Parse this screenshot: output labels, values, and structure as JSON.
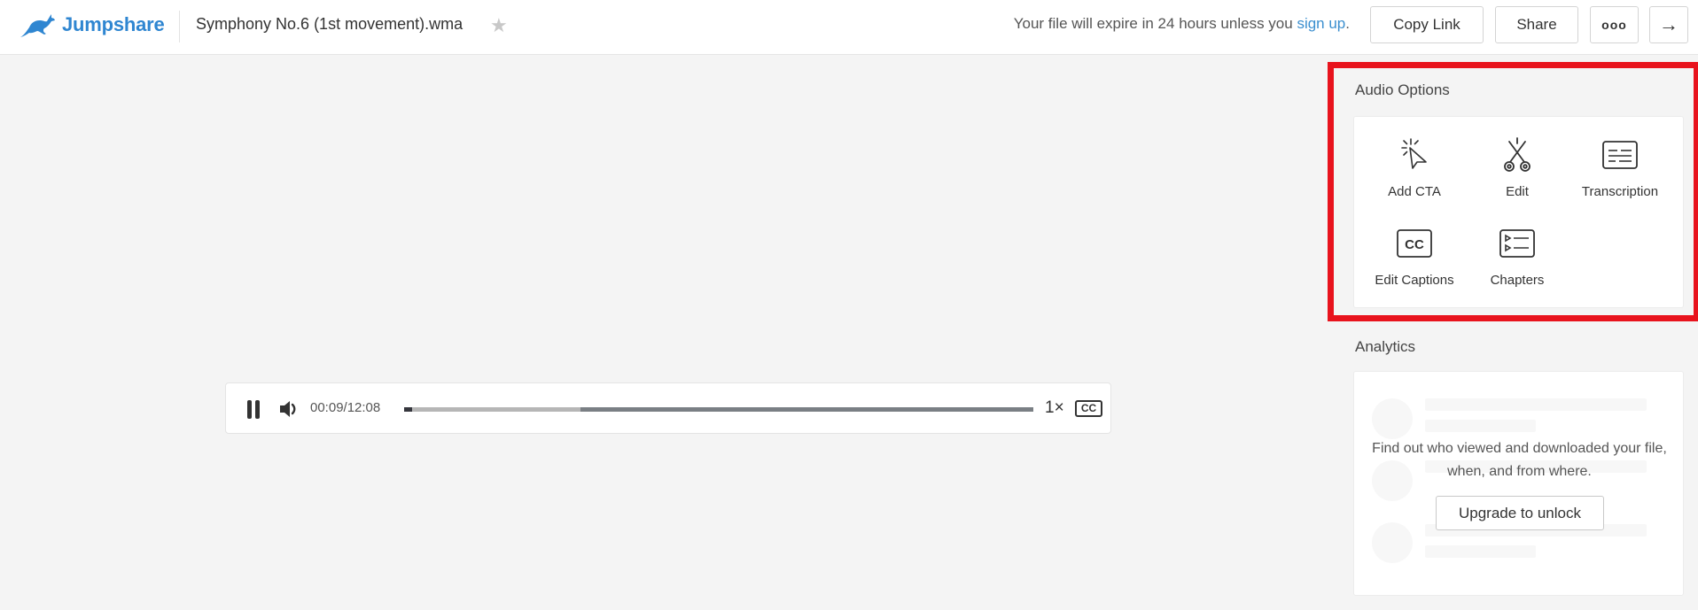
{
  "header": {
    "brand": "Jumpshare",
    "file_title": "Symphony No.6 (1st movement).wma",
    "expire_text": "Your file will expire in 24 hours unless you ",
    "expire_link": "sign up",
    "expire_suffix": ".",
    "copy_link_label": "Copy Link",
    "share_label": "Share",
    "more_label": "ooo",
    "next_label": "→"
  },
  "player": {
    "time": "00:09/12:08",
    "played_fraction": 0.012,
    "buffered_fraction": 0.28,
    "speed": "1×",
    "cc_label": "CC"
  },
  "audio_options": {
    "title": "Audio Options",
    "items": [
      {
        "label": "Add CTA",
        "icon": "cursor-click-icon"
      },
      {
        "label": "Edit",
        "icon": "scissors-icon"
      },
      {
        "label": "Transcription",
        "icon": "transcript-icon"
      },
      {
        "label": "Edit Captions",
        "icon": "cc-icon"
      },
      {
        "label": "Chapters",
        "icon": "chapters-icon"
      }
    ]
  },
  "analytics": {
    "title": "Analytics",
    "message": "Find out who viewed and downloaded your file, when, and from where.",
    "upgrade_label": "Upgrade to unlock"
  },
  "colors": {
    "brand": "#2f86d1",
    "highlight": "#e8131d",
    "link": "#3b8fcf"
  }
}
